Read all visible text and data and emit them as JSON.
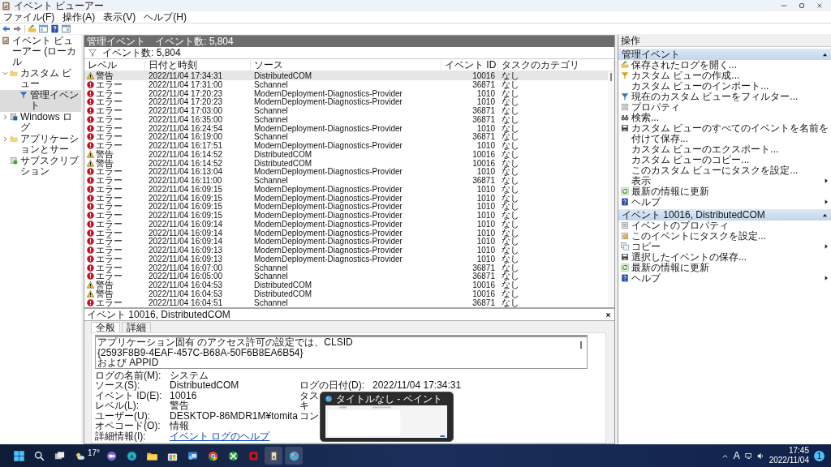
{
  "window": {
    "title": "イベント ビューアー"
  },
  "menu": [
    "ファイル(F)",
    "操作(A)",
    "表示(V)",
    "ヘルプ(H)"
  ],
  "tree": [
    {
      "label": "イベント ビューアー (ローカル",
      "kind": "viewer",
      "selected": false,
      "children": [
        {
          "label": "カスタム ビュー",
          "kind": "folder",
          "expanded": true,
          "selected": false,
          "children": [
            {
              "label": "管理イベント",
              "kind": "filter",
              "selected": true
            }
          ]
        },
        {
          "label": "Windows ログ",
          "kind": "log",
          "expanded": false,
          "selected": false
        },
        {
          "label": "アプリケーションとサー",
          "kind": "folder",
          "expanded": false,
          "selected": false
        },
        {
          "label": "サブスクリプション",
          "kind": "subs",
          "selected": false
        }
      ]
    }
  ],
  "header": {
    "title": "管理イベント",
    "count": "イベント数: 5,804"
  },
  "filter_bar": {
    "count": "イベント数: 5,804"
  },
  "table": {
    "columns": [
      "レベル",
      "日付と時刻",
      "ソース",
      "イベント ID",
      "タスクのカテゴリ"
    ],
    "rows": [
      {
        "kind": "warning",
        "level": "警告",
        "date": "2022/11/04 17:34:31",
        "source": "DistributedCOM",
        "id": "10016",
        "category": "なし",
        "selected": true
      },
      {
        "kind": "error",
        "level": "エラー",
        "date": "2022/11/04 17:31:00",
        "source": "Schannel",
        "id": "36871",
        "category": "なし",
        "selected": false
      },
      {
        "kind": "error",
        "level": "エラー",
        "date": "2022/11/04 17:20:23",
        "source": "ModernDeployment-Diagnostics-Provider",
        "id": "1010",
        "category": "なし",
        "selected": false
      },
      {
        "kind": "error",
        "level": "エラー",
        "date": "2022/11/04 17:20:23",
        "source": "ModernDeployment-Diagnostics-Provider",
        "id": "1010",
        "category": "なし",
        "selected": false
      },
      {
        "kind": "error",
        "level": "エラー",
        "date": "2022/11/04 17:03:00",
        "source": "Schannel",
        "id": "36871",
        "category": "なし",
        "selected": false
      },
      {
        "kind": "error",
        "level": "エラー",
        "date": "2022/11/04 16:35:00",
        "source": "Schannel",
        "id": "36871",
        "category": "なし",
        "selected": false
      },
      {
        "kind": "error",
        "level": "エラー",
        "date": "2022/11/04 16:24:54",
        "source": "ModernDeployment-Diagnostics-Provider",
        "id": "1010",
        "category": "なし",
        "selected": false
      },
      {
        "kind": "error",
        "level": "エラー",
        "date": "2022/11/04 16:19:00",
        "source": "Schannel",
        "id": "36871",
        "category": "なし",
        "selected": false
      },
      {
        "kind": "error",
        "level": "エラー",
        "date": "2022/11/04 16:17:51",
        "source": "ModernDeployment-Diagnostics-Provider",
        "id": "1010",
        "category": "なし",
        "selected": false
      },
      {
        "kind": "warning",
        "level": "警告",
        "date": "2022/11/04 16:14:52",
        "source": "DistributedCOM",
        "id": "10016",
        "category": "なし",
        "selected": false
      },
      {
        "kind": "warning",
        "level": "警告",
        "date": "2022/11/04 16:14:52",
        "source": "DistributedCOM",
        "id": "10016",
        "category": "なし",
        "selected": false
      },
      {
        "kind": "error",
        "level": "エラー",
        "date": "2022/11/04 16:13:04",
        "source": "ModernDeployment-Diagnostics-Provider",
        "id": "1010",
        "category": "なし",
        "selected": false
      },
      {
        "kind": "error",
        "level": "エラー",
        "date": "2022/11/04 16:11:00",
        "source": "Schannel",
        "id": "36871",
        "category": "なし",
        "selected": false
      },
      {
        "kind": "error",
        "level": "エラー",
        "date": "2022/11/04 16:09:15",
        "source": "ModernDeployment-Diagnostics-Provider",
        "id": "1010",
        "category": "なし",
        "selected": false
      },
      {
        "kind": "error",
        "level": "エラー",
        "date": "2022/11/04 16:09:15",
        "source": "ModernDeployment-Diagnostics-Provider",
        "id": "1010",
        "category": "なし",
        "selected": false
      },
      {
        "kind": "error",
        "level": "エラー",
        "date": "2022/11/04 16:09:15",
        "source": "ModernDeployment-Diagnostics-Provider",
        "id": "1010",
        "category": "なし",
        "selected": false
      },
      {
        "kind": "error",
        "level": "エラー",
        "date": "2022/11/04 16:09:15",
        "source": "ModernDeployment-Diagnostics-Provider",
        "id": "1010",
        "category": "なし",
        "selected": false
      },
      {
        "kind": "error",
        "level": "エラー",
        "date": "2022/11/04 16:09:14",
        "source": "ModernDeployment-Diagnostics-Provider",
        "id": "1010",
        "category": "なし",
        "selected": false
      },
      {
        "kind": "error",
        "level": "エラー",
        "date": "2022/11/04 16:09:14",
        "source": "ModernDeployment-Diagnostics-Provider",
        "id": "1010",
        "category": "なし",
        "selected": false
      },
      {
        "kind": "error",
        "level": "エラー",
        "date": "2022/11/04 16:09:14",
        "source": "ModernDeployment-Diagnostics-Provider",
        "id": "1010",
        "category": "なし",
        "selected": false
      },
      {
        "kind": "error",
        "level": "エラー",
        "date": "2022/11/04 16:09:13",
        "source": "ModernDeployment-Diagnostics-Provider",
        "id": "1010",
        "category": "なし",
        "selected": false
      },
      {
        "kind": "error",
        "level": "エラー",
        "date": "2022/11/04 16:09:13",
        "source": "ModernDeployment-Diagnostics-Provider",
        "id": "1010",
        "category": "なし",
        "selected": false
      },
      {
        "kind": "error",
        "level": "エラー",
        "date": "2022/11/04 16:07:00",
        "source": "Schannel",
        "id": "36871",
        "category": "なし",
        "selected": false
      },
      {
        "kind": "error",
        "level": "エラー",
        "date": "2022/11/04 16:05:00",
        "source": "Schannel",
        "id": "36871",
        "category": "なし",
        "selected": false
      },
      {
        "kind": "warning",
        "level": "警告",
        "date": "2022/11/04 16:04:53",
        "source": "DistributedCOM",
        "id": "10016",
        "category": "なし",
        "selected": false
      },
      {
        "kind": "warning",
        "level": "警告",
        "date": "2022/11/04 16:04:53",
        "source": "DistributedCOM",
        "id": "10016",
        "category": "なし",
        "selected": false
      },
      {
        "kind": "error",
        "level": "エラー",
        "date": "2022/11/04 16:04:51",
        "source": "Schannel",
        "id": "36871",
        "category": "なし",
        "selected": false
      }
    ]
  },
  "details": {
    "title": "イベント 10016, DistributedCOM",
    "tabs": [
      {
        "label": "全般",
        "selected": true
      },
      {
        "label": "詳細",
        "selected": false
      }
    ],
    "description": "アプリケーション固有 のアクセス許可の設定では、CLSID\n{2593F8B9-4EAF-457C-B68A-50F6B8EA6B54}\n および APPID",
    "fields": [
      [
        {
          "label": "ログの名前(M):",
          "value": "システム"
        }
      ],
      [
        {
          "label": "ソース(S):",
          "value": "DistributedCOM"
        },
        {
          "label": "ログの日付(D):",
          "value": "2022/11/04 17:34:31"
        }
      ],
      [
        {
          "label": "イベント ID(E):",
          "value": "10016"
        },
        {
          "label": "タス"
        }
      ],
      [
        {
          "label": "レベル(L):",
          "value": "警告"
        },
        {
          "label": "キ"
        }
      ],
      [
        {
          "label": "ユーザー(U):",
          "value": "DESKTOP-86MDR1M¥tomita"
        },
        {
          "label": "コン"
        }
      ],
      [
        {
          "label": "オペコード(O):",
          "value": "情報"
        }
      ],
      [
        {
          "label": "詳細情報(I):",
          "value": "イベント ログのヘルプ",
          "kind": "link"
        }
      ]
    ]
  },
  "actions": {
    "title": "操作",
    "sections": [
      {
        "title": "管理イベント",
        "expanded": true,
        "items": [
          {
            "label": "保存されたログを開く...",
            "kind": "open",
            "submenu": false
          },
          {
            "label": "カスタム ビューの作成...",
            "kind": "create",
            "submenu": false
          },
          {
            "label": "カスタム ビューのインポート...",
            "kind": "none",
            "submenu": false
          },
          {
            "label": "現在のカスタム ビューをフィルター...",
            "kind": "filter",
            "submenu": false
          },
          {
            "label": "プロパティ",
            "kind": "properties",
            "submenu": false
          },
          {
            "label": "検索...",
            "kind": "find",
            "submenu": false
          },
          {
            "label": "カスタム ビューのすべてのイベントを名前を付けて保存...",
            "kind": "save",
            "submenu": false
          },
          {
            "label": "カスタム ビューのエクスポート...",
            "kind": "none",
            "submenu": false
          },
          {
            "label": "カスタム ビューのコピー...",
            "kind": "none",
            "submenu": false
          },
          {
            "label": "このカスタム ビューにタスクを設定...",
            "kind": "none",
            "submenu": false
          },
          {
            "label": "表示",
            "kind": "none",
            "submenu": true
          },
          {
            "label": "最新の情報に更新",
            "kind": "refresh",
            "submenu": false
          },
          {
            "label": "ヘルプ",
            "kind": "help",
            "submenu": true
          }
        ]
      },
      {
        "title": "イベント 10016, DistributedCOM",
        "expanded": true,
        "items": [
          {
            "label": "イベントのプロパティ",
            "kind": "properties",
            "submenu": false
          },
          {
            "label": "このイベントにタスクを設定...",
            "kind": "task",
            "submenu": false
          },
          {
            "label": "コピー",
            "kind": "copy",
            "submenu": true
          },
          {
            "label": "選択したイベントの保存...",
            "kind": "save",
            "submenu": false
          },
          {
            "label": "最新の情報に更新",
            "kind": "refresh",
            "submenu": false
          },
          {
            "label": "ヘルプ",
            "kind": "help",
            "submenu": true
          }
        ]
      }
    ]
  },
  "preview": {
    "title": "タイトルなし - ペイント"
  },
  "taskbar": {
    "weather": "17°",
    "apps": [
      {
        "kind": "start",
        "selected": false
      },
      {
        "kind": "search",
        "selected": false
      },
      {
        "kind": "taskview",
        "selected": false
      },
      {
        "kind": "weather",
        "selected": false
      },
      {
        "kind": "chat",
        "selected": false
      },
      {
        "kind": "edge",
        "selected": false
      },
      {
        "kind": "explorer",
        "selected": false
      },
      {
        "kind": "store",
        "selected": false
      },
      {
        "kind": "photos",
        "selected": false
      },
      {
        "kind": "chrome",
        "selected": false
      },
      {
        "kind": "xbox",
        "selected": false
      },
      {
        "kind": "red",
        "selected": false
      },
      {
        "kind": "viewer",
        "selected": true
      },
      {
        "kind": "paint",
        "selected": true
      }
    ],
    "ime": "A",
    "time": "17:45",
    "date": "2022/11/04",
    "notifications": "1"
  }
}
